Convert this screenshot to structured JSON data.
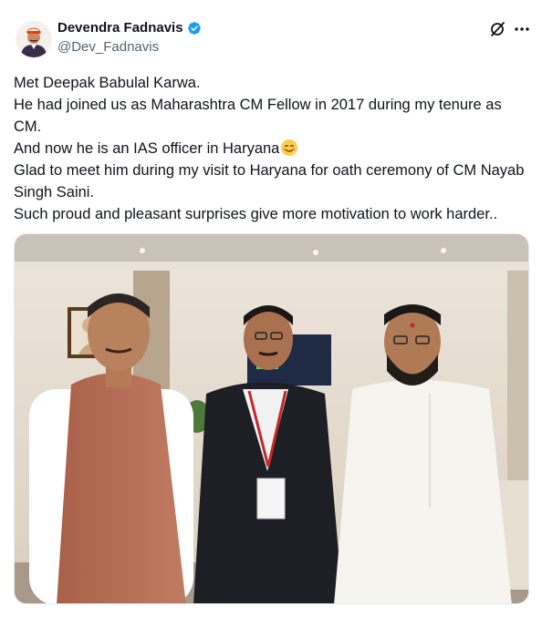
{
  "author": {
    "display_name": "Devendra Fadnavis",
    "handle": "@Dev_Fadnavis",
    "verified": true,
    "verified_color": "#1d9bf0"
  },
  "actions": {
    "grok_icon": "grok-icon",
    "more_icon": "more-icon"
  },
  "tweet": {
    "lines": [
      "Met Deepak Babulal Karwa.",
      "He had joined us as Maharashtra CM Fellow in 2017 during my tenure as CM.",
      "And now he is an IAS officer in Haryana",
      "Glad to meet him during my visit to Haryana for oath ceremony of CM Nayab Singh Saini.",
      "Such proud and pleasant surprises give more motivation to work harder.."
    ],
    "emoji": "smiling-face-emoji"
  },
  "media": {
    "type": "photo"
  },
  "colors": {
    "text": "#0f1419",
    "secondary": "#536471"
  }
}
